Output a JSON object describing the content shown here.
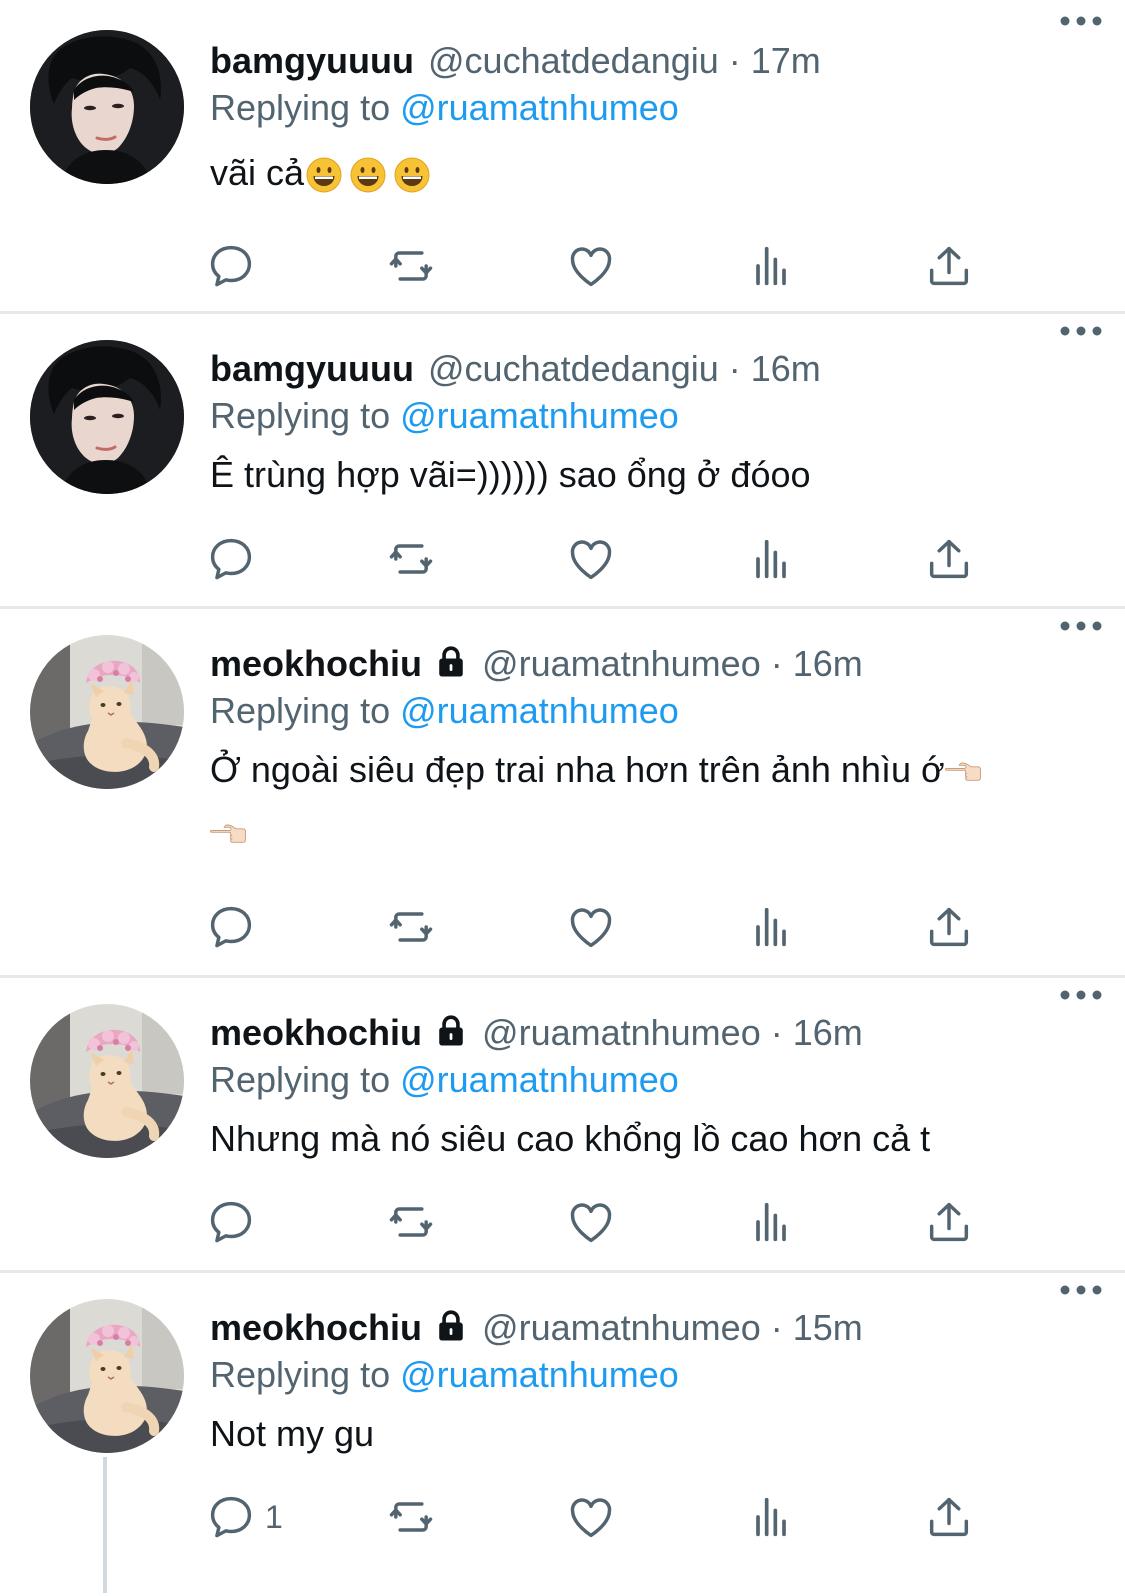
{
  "tweets": [
    {
      "avatar": "person-avatar",
      "name": "bamgyuuuu",
      "locked": false,
      "handle": "@cuchatdedangiu",
      "separator": "·",
      "time": "17m",
      "replying_prefix": "Replying to",
      "replying_to": "@ruamatnhumeo",
      "text": "vãi cả",
      "emojis": [
        "grinning-face",
        "grinning-face",
        "grinning-face"
      ],
      "reply_count": ""
    },
    {
      "avatar": "person-avatar",
      "name": "bamgyuuuu",
      "locked": false,
      "handle": "@cuchatdedangiu",
      "separator": "·",
      "time": "16m",
      "replying_prefix": "Replying to",
      "replying_to": "@ruamatnhumeo",
      "text": "Ê trùng hợp vãi=)))))) sao ổng ở đóoo",
      "emojis": [],
      "reply_count": ""
    },
    {
      "avatar": "cat-avatar",
      "name": "meokhochiu",
      "locked": true,
      "handle": "@ruamatnhumeo",
      "separator": "·",
      "time": "16m",
      "replying_prefix": "Replying to",
      "replying_to": "@ruamatnhumeo",
      "text": "Ở ngoài siêu đẹp trai nha hơn trên ảnh nhìu ớ",
      "emojis": [
        "pointing-left",
        "pointing-left"
      ],
      "reply_count": ""
    },
    {
      "avatar": "cat-avatar",
      "name": "meokhochiu",
      "locked": true,
      "handle": "@ruamatnhumeo",
      "separator": "·",
      "time": "16m",
      "replying_prefix": "Replying to",
      "replying_to": "@ruamatnhumeo",
      "text": "Nhưng mà nó siêu cao khổng lồ cao hơn cả t",
      "emojis": [],
      "reply_count": ""
    },
    {
      "avatar": "cat-avatar",
      "name": "meokhochiu",
      "locked": true,
      "handle": "@ruamatnhumeo",
      "separator": "·",
      "time": "15m",
      "replying_prefix": "Replying to",
      "replying_to": "@ruamatnhumeo",
      "text": "Not my gu",
      "emojis": [],
      "reply_count": "1"
    }
  ],
  "icons": {
    "reply": "reply-icon",
    "retweet": "retweet-icon",
    "like": "heart-icon",
    "views": "views-icon",
    "share": "share-icon",
    "more": "more-icon",
    "lock": "lock-icon"
  },
  "colors": {
    "text": "#0f1419",
    "muted": "#536471",
    "link": "#1d9bf0",
    "divider": "#e6e9eb",
    "icon": "#536471"
  }
}
